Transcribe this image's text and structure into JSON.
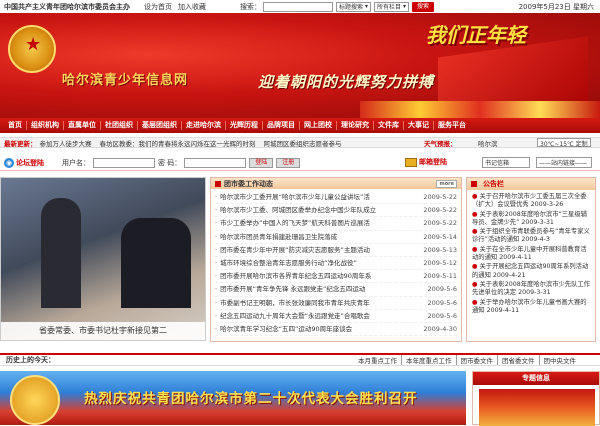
{
  "topbar": {
    "org_line": "中国共产主义青年团哈尔滨市委员会主办",
    "homepage_link": "设为首页",
    "favorite_link": "加入收藏",
    "search_label": "搜索：",
    "search_value": "",
    "search_type": "标题搜索",
    "search_scope": "所有栏目",
    "search_button": "搜索",
    "date": "2009年5月23日",
    "weekday": "星期六"
  },
  "banner": {
    "site_title": "哈尔滨青少年信息网",
    "slogan": "迎着朝阳的光辉努力拼搏",
    "youth_text": "我们正年轻"
  },
  "nav": {
    "items": [
      "首页",
      "组织机构",
      "直属单位",
      "社团组织",
      "基层团组织",
      "走进哈尔滨",
      "光辉历程",
      "品牌项目",
      "网上团校",
      "理论研究",
      "文件库",
      "大事记",
      "服务平台"
    ]
  },
  "newsbar": {
    "label": "最新更新：",
    "items": [
      "参加万人徒步大赛",
      "春坊区教委：我们的青春将永远闪烁在这一光辉的时刻",
      "阿城团区委组织志愿者参与"
    ],
    "weather_label": "天气预报：",
    "weather_city": "哈尔滨",
    "weather_value": "30℃~15℃ 定制"
  },
  "login": {
    "forum_label": "论坛登陆",
    "user_label": "用户名：",
    "pass_label": "密 码：",
    "login_button": "登陆",
    "register_button": "注册",
    "mail_label": "邮箱登陆",
    "group_select": "书记信箱",
    "site_select": "——站内链接——"
  },
  "photo": {
    "caption": "省委常委、市委书记杜宇新接见第二"
  },
  "center": {
    "title": "团市委工作动态",
    "more": "more",
    "items": [
      {
        "t": "哈尔滨市少工委开展“哈尔滨市少年儿童公益讲坛”活",
        "d": "2009-5-22"
      },
      {
        "t": "哈尔滨市少工委、阿城团区委举办纪念中国少年队成立",
        "d": "2009-5-22"
      },
      {
        "t": "市少工委举办“中国人的飞天梦”航天科普图片巡展活",
        "d": "2009-5-22"
      },
      {
        "t": "哈尔滨市团员青年捐建赴珊昌卫生院落成",
        "d": "2009-5-14"
      },
      {
        "t": "团市委在青少年中开展“防灾减灾志愿服务”主题活动",
        "d": "2009-5-13"
      },
      {
        "t": "城市环境综合整治青年志愿服务行动“净化战役”",
        "d": "2009-5-12"
      },
      {
        "t": "团市委开展哈尔滨市各界青年纪念五四运动90周年系",
        "d": "2009-5-11"
      },
      {
        "t": "团市委开展“青年争先锋 永远跟党走”纪念五四运动",
        "d": "2009-5-6"
      },
      {
        "t": "市委副书记王明朝，市长张效廉同我市青年共庆青年",
        "d": "2009-5-6"
      },
      {
        "t": "纪念五四运动九十周年大会暨“永远跟党走”合唱歌会",
        "d": "2009-5-6"
      },
      {
        "t": "哈尔滨青年学习纪念“五四”运动90周年座谈会",
        "d": "2009-4-30"
      }
    ]
  },
  "notice": {
    "title": "公告栏",
    "items": [
      "关于召开哈尔滨市少工委五届三次全委（扩大）会议暨优秀 2009-3-26",
      "关于表彰2008年度哈尔滨市“三星级辅导员、金牌少先” 2009-3-31",
      "关于组织全市青联委员参与“青年专家义诊行”活动的通知 2009-4-3",
      "关于在全市少年儿童中开展科普教育活动的通知 2009-4-11",
      "关于开展纪念五四运动90周年系列活动的通知 2009-4-21",
      "关于表彰2008年度哈尔滨市少先队工作先进单位的决定 2009-3-31",
      "关于举办哈尔滨市少年儿童书画大赛的通知 2009-4-11"
    ]
  },
  "history": {
    "label": "历史上的今天：",
    "tabs": [
      "本月重点工作",
      "本年度重点工作",
      "团市委文件",
      "团省委文件",
      "团中央文件"
    ]
  },
  "bottom_banner": {
    "text": "热烈庆祝共青团哈尔滨市第二十次代表大会胜利召开"
  },
  "special": {
    "title": "专题信息"
  }
}
